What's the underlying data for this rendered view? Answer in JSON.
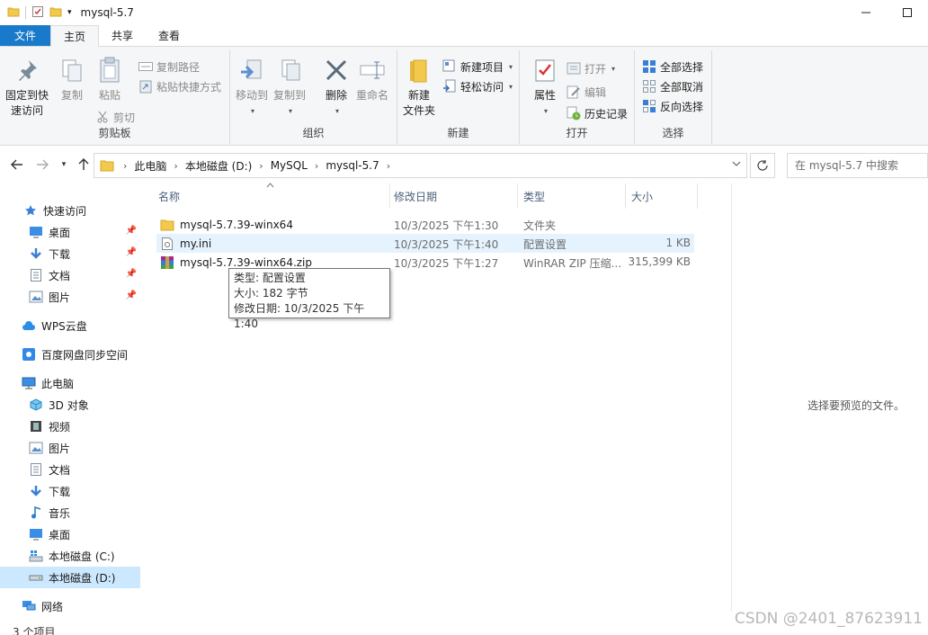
{
  "window": {
    "title": "mysql-5.7"
  },
  "tabs": [
    {
      "label": "文件"
    },
    {
      "label": "主页"
    },
    {
      "label": "共享"
    },
    {
      "label": "查看"
    }
  ],
  "ribbon": {
    "clipboard": {
      "label": "剪贴板",
      "pin_quick": "固定到快\n速访问",
      "pin_quick_1": "固定到快",
      "pin_quick_2": "速访问",
      "copy": "复制",
      "paste": "粘贴",
      "copy_path": "复制路径",
      "paste_shortcut": "粘贴快捷方式",
      "cut": "剪切"
    },
    "organize": {
      "label": "组织",
      "move_to": "移动到",
      "copy_to": "复制到",
      "delete": "删除",
      "rename": "重命名"
    },
    "new": {
      "label": "新建",
      "new_folder_1": "新建",
      "new_folder_2": "文件夹",
      "new_item": "新建项目",
      "easy_access": "轻松访问"
    },
    "open": {
      "label": "打开",
      "properties": "属性",
      "open": "打开",
      "edit": "编辑",
      "history": "历史记录"
    },
    "select": {
      "label": "选择",
      "select_all": "全部选择",
      "select_none": "全部取消",
      "invert": "反向选择"
    }
  },
  "address": {
    "crumbs": [
      "此电脑",
      "本地磁盘 (D:)",
      "MySQL",
      "mysql-5.7"
    ],
    "search_placeholder": "在 mysql-5.7 中搜索"
  },
  "nav": {
    "quick_access": "快速访问",
    "desktop": "桌面",
    "downloads": "下载",
    "documents": "文档",
    "pictures": "图片",
    "wps": "WPS云盘",
    "baidu": "百度网盘同步空间",
    "this_pc": "此电脑",
    "objects3d": "3D 对象",
    "videos": "视频",
    "pictures2": "图片",
    "documents2": "文档",
    "downloads2": "下载",
    "music": "音乐",
    "desktop2": "桌面",
    "drive_c": "本地磁盘 (C:)",
    "drive_d": "本地磁盘 (D:)",
    "network": "网络"
  },
  "columns": {
    "name": "名称",
    "date": "修改日期",
    "type": "类型",
    "size": "大小"
  },
  "files": [
    {
      "name": "mysql-5.7.39-winx64",
      "date": "10/3/2025 下午1:30",
      "type": "文件夹",
      "size": ""
    },
    {
      "name": "my.ini",
      "date": "10/3/2025 下午1:40",
      "type": "配置设置",
      "size": "1 KB"
    },
    {
      "name": "mysql-5.7.39-winx64.zip",
      "date": "10/3/2025 下午1:27",
      "type": "WinRAR ZIP 压缩...",
      "size": "315,399 KB"
    }
  ],
  "tooltip": {
    "type": "类型: 配置设置",
    "size": "大小: 182 字节",
    "modified": "修改日期: 10/3/2025 下午1:40"
  },
  "preview": {
    "text": "选择要预览的文件。"
  },
  "status": {
    "count": "3 个项目"
  },
  "watermark": "CSDN @2401_87623911",
  "colors": {
    "accent": "#1979ca",
    "folder": "#f2c94c",
    "selection": "#cce8ff",
    "hover": "#e5f3ff"
  }
}
